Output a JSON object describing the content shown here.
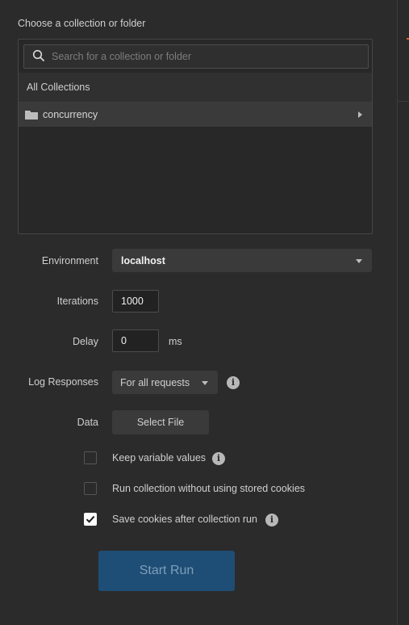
{
  "collection_picker": {
    "title": "Choose a collection or folder",
    "search_placeholder": "Search for a collection or folder",
    "all_collections_label": "All Collections",
    "items": [
      {
        "label": "concurrency",
        "icon": "folder-icon"
      }
    ]
  },
  "environment": {
    "label": "Environment",
    "selected": "localhost"
  },
  "iterations": {
    "label": "Iterations",
    "value": "1000"
  },
  "delay": {
    "label": "Delay",
    "value": "0",
    "unit": "ms"
  },
  "log_responses": {
    "label": "Log Responses",
    "selected": "For all requests"
  },
  "data": {
    "label": "Data",
    "button_label": "Select File"
  },
  "options": [
    {
      "label": "Keep variable values",
      "checked": false,
      "has_info": true
    },
    {
      "label": "Run collection without using stored cookies",
      "checked": false,
      "has_info": false
    },
    {
      "label": "Save cookies after collection run",
      "checked": true,
      "has_info": true
    }
  ],
  "start_button": {
    "label": "Start Run"
  },
  "colors": {
    "background": "#2b2b2b",
    "accent": "#e0612a",
    "start_button_bg": "#1e4d75",
    "start_button_text": "#7f9fbb"
  }
}
